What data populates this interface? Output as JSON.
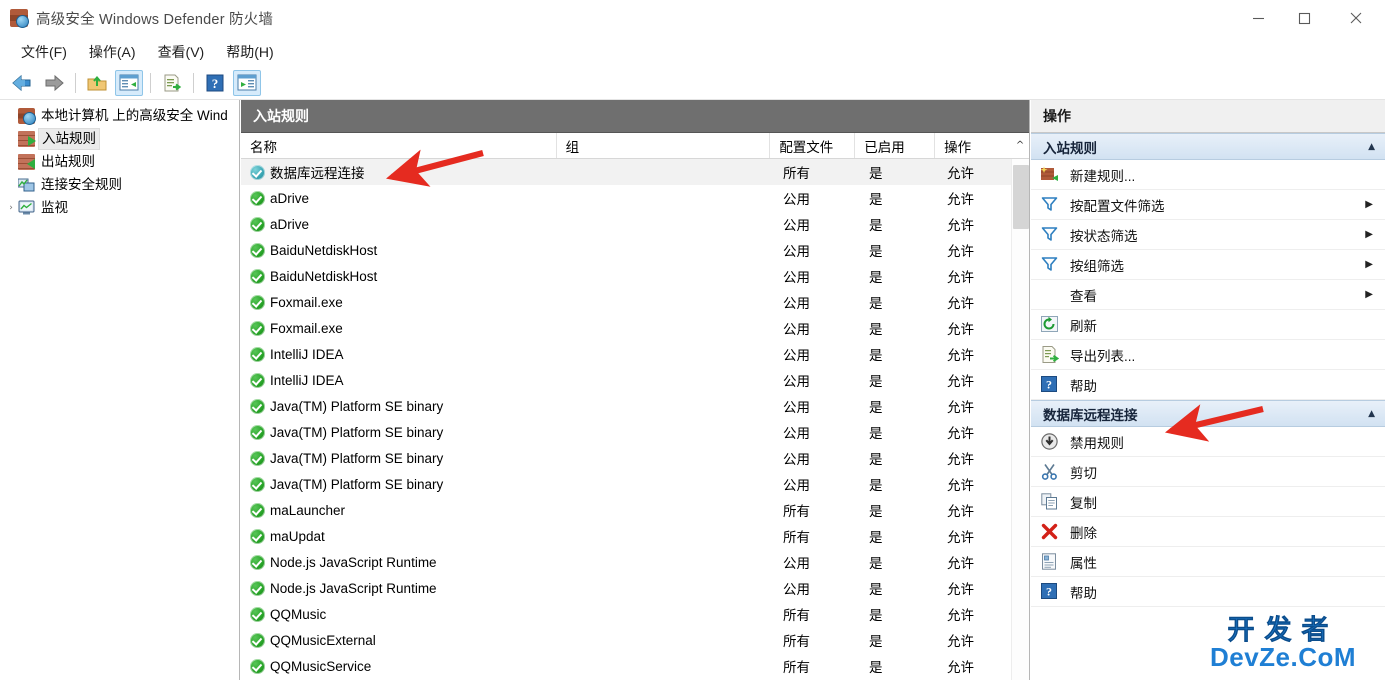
{
  "window": {
    "title": "高级安全 Windows Defender 防火墙",
    "app_icon": "firewall-icon",
    "minimize": "—",
    "maximize": "▢",
    "close": "✕"
  },
  "menubar": {
    "items": [
      {
        "label": "文件(F)",
        "name": "menu-file"
      },
      {
        "label": "操作(A)",
        "name": "menu-action"
      },
      {
        "label": "查看(V)",
        "name": "menu-view"
      },
      {
        "label": "帮助(H)",
        "name": "menu-help"
      }
    ]
  },
  "toolbar": {
    "buttons": [
      {
        "name": "back-icon",
        "icon": "back-arrow",
        "active": false
      },
      {
        "name": "forward-icon",
        "icon": "forward-arrow",
        "active": false
      },
      {
        "name": "up-one-level-icon",
        "icon": "folder-up",
        "active": false
      },
      {
        "name": "show-hide-tree-icon",
        "icon": "console-tree",
        "active": true
      },
      {
        "name": "export-list-icon",
        "icon": "export-list",
        "active": false
      },
      {
        "name": "help-icon",
        "icon": "question-mark",
        "active": false
      },
      {
        "name": "show-action-pane-icon",
        "icon": "action-pane",
        "active": true
      }
    ]
  },
  "sidebar": {
    "items": [
      {
        "label": "本地计算机 上的高级安全 Wind",
        "icon": "firewall-icon",
        "indent": 0,
        "expander": "",
        "selected": false
      },
      {
        "label": "入站规则",
        "icon": "inbound-rules-icon",
        "indent": 1,
        "expander": "",
        "selected": true
      },
      {
        "label": "出站规则",
        "icon": "outbound-rules-icon",
        "indent": 1,
        "expander": "",
        "selected": false
      },
      {
        "label": "连接安全规则",
        "icon": "connection-security-icon",
        "indent": 1,
        "expander": "",
        "selected": false
      },
      {
        "label": "监视",
        "icon": "monitoring-icon",
        "indent": 1,
        "expander": "›",
        "selected": false
      }
    ]
  },
  "center": {
    "caption": "入站规则",
    "columns": [
      {
        "key": "name",
        "label": "名称"
      },
      {
        "key": "group",
        "label": "组"
      },
      {
        "key": "profile",
        "label": "配置文件"
      },
      {
        "key": "enabled",
        "label": "已启用"
      },
      {
        "key": "action",
        "label": "操作"
      }
    ],
    "sort_indicator": "^",
    "rows": [
      {
        "name": "数据库远程连接",
        "group": "",
        "profile": "所有",
        "enabled": "是",
        "action": "允许",
        "icon": "allow-rule-icon-teal",
        "selected": true
      },
      {
        "name": "aDrive",
        "group": "",
        "profile": "公用",
        "enabled": "是",
        "action": "允许",
        "icon": "allow-rule-icon",
        "selected": false
      },
      {
        "name": "aDrive",
        "group": "",
        "profile": "公用",
        "enabled": "是",
        "action": "允许",
        "icon": "allow-rule-icon",
        "selected": false
      },
      {
        "name": "BaiduNetdiskHost",
        "group": "",
        "profile": "公用",
        "enabled": "是",
        "action": "允许",
        "icon": "allow-rule-icon",
        "selected": false
      },
      {
        "name": "BaiduNetdiskHost",
        "group": "",
        "profile": "公用",
        "enabled": "是",
        "action": "允许",
        "icon": "allow-rule-icon",
        "selected": false
      },
      {
        "name": "Foxmail.exe",
        "group": "",
        "profile": "公用",
        "enabled": "是",
        "action": "允许",
        "icon": "allow-rule-icon",
        "selected": false
      },
      {
        "name": "Foxmail.exe",
        "group": "",
        "profile": "公用",
        "enabled": "是",
        "action": "允许",
        "icon": "allow-rule-icon",
        "selected": false
      },
      {
        "name": "IntelliJ IDEA",
        "group": "",
        "profile": "公用",
        "enabled": "是",
        "action": "允许",
        "icon": "allow-rule-icon",
        "selected": false
      },
      {
        "name": "IntelliJ IDEA",
        "group": "",
        "profile": "公用",
        "enabled": "是",
        "action": "允许",
        "icon": "allow-rule-icon",
        "selected": false
      },
      {
        "name": "Java(TM) Platform SE binary",
        "group": "",
        "profile": "公用",
        "enabled": "是",
        "action": "允许",
        "icon": "allow-rule-icon",
        "selected": false
      },
      {
        "name": "Java(TM) Platform SE binary",
        "group": "",
        "profile": "公用",
        "enabled": "是",
        "action": "允许",
        "icon": "allow-rule-icon",
        "selected": false
      },
      {
        "name": "Java(TM) Platform SE binary",
        "group": "",
        "profile": "公用",
        "enabled": "是",
        "action": "允许",
        "icon": "allow-rule-icon",
        "selected": false
      },
      {
        "name": "Java(TM) Platform SE binary",
        "group": "",
        "profile": "公用",
        "enabled": "是",
        "action": "允许",
        "icon": "allow-rule-icon",
        "selected": false
      },
      {
        "name": "maLauncher",
        "group": "",
        "profile": "所有",
        "enabled": "是",
        "action": "允许",
        "icon": "allow-rule-icon",
        "selected": false
      },
      {
        "name": "maUpdat",
        "group": "",
        "profile": "所有",
        "enabled": "是",
        "action": "允许",
        "icon": "allow-rule-icon",
        "selected": false
      },
      {
        "name": "Node.js JavaScript Runtime",
        "group": "",
        "profile": "公用",
        "enabled": "是",
        "action": "允许",
        "icon": "allow-rule-icon",
        "selected": false
      },
      {
        "name": "Node.js JavaScript Runtime",
        "group": "",
        "profile": "公用",
        "enabled": "是",
        "action": "允许",
        "icon": "allow-rule-icon",
        "selected": false
      },
      {
        "name": "QQMusic",
        "group": "",
        "profile": "所有",
        "enabled": "是",
        "action": "允许",
        "icon": "allow-rule-icon",
        "selected": false
      },
      {
        "name": "QQMusicExternal",
        "group": "",
        "profile": "所有",
        "enabled": "是",
        "action": "允许",
        "icon": "allow-rule-icon",
        "selected": false
      },
      {
        "name": "QQMusicService",
        "group": "",
        "profile": "所有",
        "enabled": "是",
        "action": "允许",
        "icon": "allow-rule-icon",
        "selected": false
      }
    ]
  },
  "actions": {
    "caption": "操作",
    "groups": [
      {
        "title": "入站规则",
        "collapse_icon": "▲",
        "items": [
          {
            "label": "新建规则...",
            "icon": "new-rule-icon",
            "submenu": false
          },
          {
            "label": "按配置文件筛选",
            "icon": "filter-icon",
            "submenu": true
          },
          {
            "label": "按状态筛选",
            "icon": "filter-icon",
            "submenu": true
          },
          {
            "label": "按组筛选",
            "icon": "filter-icon",
            "submenu": true
          },
          {
            "label": "查看",
            "icon": "",
            "submenu": true
          },
          {
            "label": "刷新",
            "icon": "refresh-icon",
            "submenu": false
          },
          {
            "label": "导出列表...",
            "icon": "export-list-icon",
            "submenu": false
          },
          {
            "label": "帮助",
            "icon": "help-icon",
            "submenu": false
          }
        ]
      },
      {
        "title": "数据库远程连接",
        "collapse_icon": "▲",
        "items": [
          {
            "label": "禁用规则",
            "icon": "disable-rule-icon",
            "submenu": false
          },
          {
            "label": "剪切",
            "icon": "cut-icon",
            "submenu": false
          },
          {
            "label": "复制",
            "icon": "copy-icon",
            "submenu": false
          },
          {
            "label": "删除",
            "icon": "delete-icon",
            "submenu": false
          },
          {
            "label": "属性",
            "icon": "properties-icon",
            "submenu": false
          },
          {
            "label": "帮助",
            "icon": "help-icon",
            "submenu": false
          }
        ]
      }
    ]
  },
  "annotations": {
    "color": "#e52b20",
    "arrows": [
      {
        "name": "annotation-arrow-selected-rule",
        "points_to": "数据库远程连接"
      },
      {
        "name": "annotation-arrow-actions-group",
        "points_to": "数据库远程连接"
      }
    ]
  },
  "watermark": {
    "line1": "开发者",
    "line2": "DevZe.CoM",
    "color": "#1f7fd4"
  }
}
